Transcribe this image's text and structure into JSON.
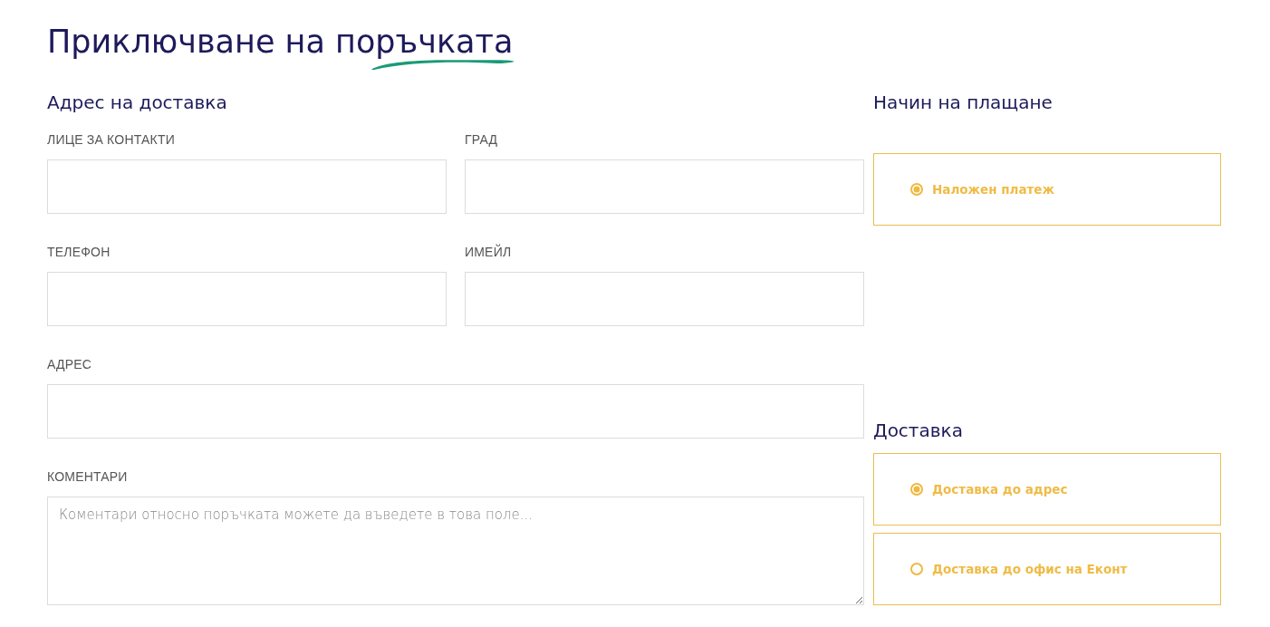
{
  "title": "Приключване на поръчката",
  "address": {
    "heading": "Адрес на доставка",
    "fields": [
      {
        "label": "ЛИЦЕ ЗА КОНТАКТИ",
        "kind": "input"
      },
      {
        "label": "ГРАД",
        "kind": "input"
      },
      {
        "label": "ТЕЛЕФОН",
        "kind": "input"
      },
      {
        "label": "ИМЕЙЛ",
        "kind": "input"
      },
      {
        "label": "АДРЕС",
        "kind": "wide-input"
      },
      {
        "label": "КОМЕНТАРИ",
        "kind": "textarea",
        "placeholder": "Коментари относно поръчката можете да въведете в това поле..."
      }
    ]
  },
  "payment": {
    "heading": "Начин на плащане",
    "options": [
      {
        "label": "Наложен платеж",
        "selected": true
      }
    ]
  },
  "delivery": {
    "heading": "Доставка",
    "options": [
      {
        "label": "Доставка до адрес",
        "selected": true
      },
      {
        "label": "Доставка до офис на Еконт",
        "selected": false
      }
    ]
  }
}
